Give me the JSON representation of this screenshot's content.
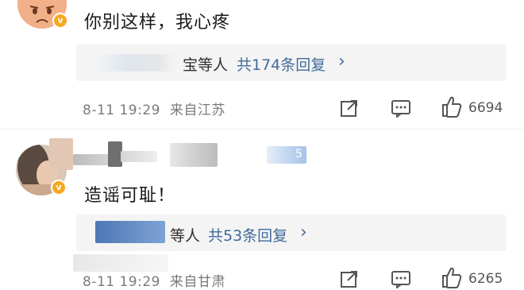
{
  "comments": [
    {
      "text": "你别这样，我心疼",
      "verified_badge": "v",
      "reply": {
        "partial_names": "宝等人",
        "count_label": "共174条回复",
        "chevron": "›"
      },
      "date": "8-11 19:29",
      "location": "来自江苏",
      "likes": "6694"
    },
    {
      "text": "造谣可耻！",
      "verified_badge": "v",
      "username_fragment": "5",
      "reply": {
        "partial_names": "等人",
        "count_label": "共53条回复",
        "chevron": "›"
      },
      "date": "8-11 19:29",
      "location": "来自甘肃",
      "likes": "6265"
    }
  ],
  "icons": {
    "share": "share-icon",
    "comment": "comment-icon",
    "like": "thumbs-up-icon"
  },
  "colors": {
    "link": "#416b9a",
    "badge": "#f7a822",
    "reply_bg": "#f4f4f4",
    "meta": "#7a7a7a"
  }
}
